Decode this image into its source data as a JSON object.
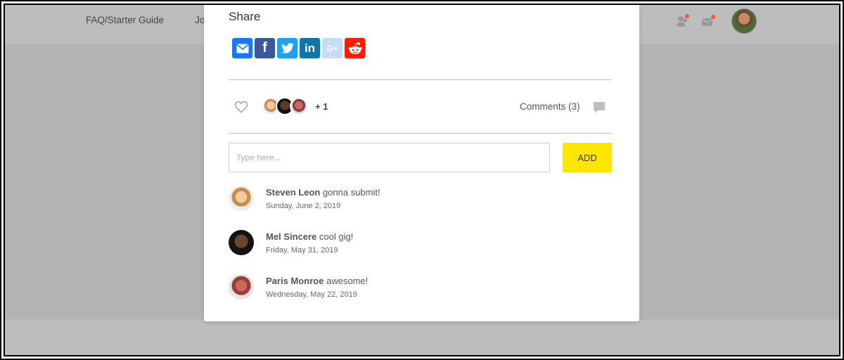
{
  "nav": {
    "faq": "FAQ/Starter Guide",
    "partial": "Jo"
  },
  "modal": {
    "share_title": "Share",
    "share_buttons": [
      {
        "name": "email",
        "color": "#1877f2",
        "label": "✉"
      },
      {
        "name": "facebook",
        "color": "#3b5998",
        "label": "f"
      },
      {
        "name": "twitter",
        "color": "#1da1f2",
        "label": "🐦"
      },
      {
        "name": "linkedin",
        "color": "#0e76a8",
        "label": "in"
      },
      {
        "name": "google-plus",
        "color": "#c7dcf7",
        "label": "G+"
      },
      {
        "name": "reddit",
        "color": "#ff1a00",
        "label": "👽"
      }
    ],
    "likes_more": "+ 1",
    "comments_count": "Comments (3)",
    "input_placeholder": "Type here...",
    "add_label": "ADD",
    "comments": [
      {
        "name": "Steven Leon",
        "text": " gonna submit!",
        "date": "Sunday, June 2, 2019"
      },
      {
        "name": "Mel Sincere",
        "text": " cool gig!",
        "date": "Friday, May 31, 2019"
      },
      {
        "name": "Paris Monroe",
        "text": " awesome!",
        "date": "Wednesday, May 22, 2019"
      }
    ]
  },
  "colors": {
    "accent": "#ffe600",
    "notification_dot": "#e8602a"
  }
}
